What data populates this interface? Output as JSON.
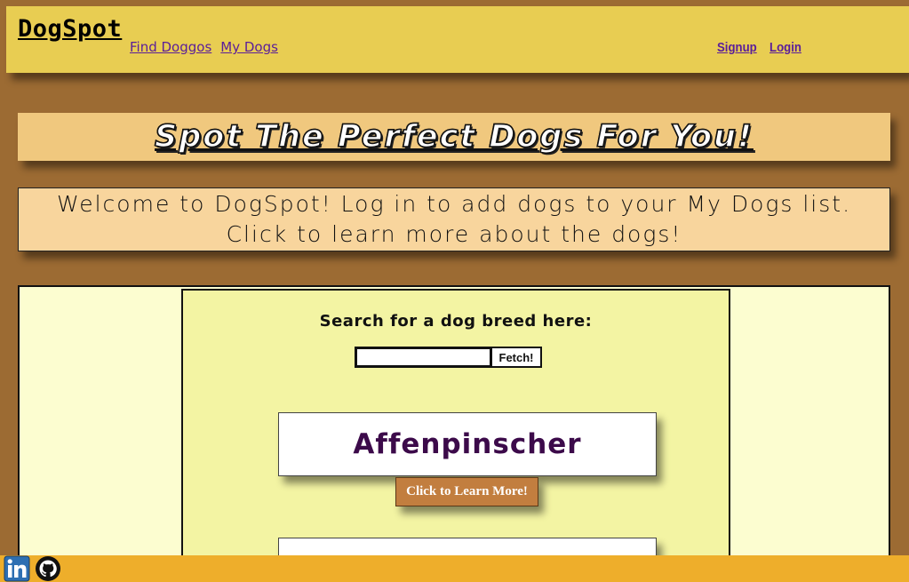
{
  "header": {
    "logo": "DogSpot",
    "nav_left": [
      "Find Doggos",
      "My Dogs"
    ],
    "nav_right": [
      "Signup",
      "Login"
    ]
  },
  "title_banner": {
    "text": "Spot The Perfect Dogs For You!"
  },
  "welcome_banner": {
    "line1": "Welcome to DogSpot! Log in to add dogs to your My Dogs list.",
    "line2": "Click to learn more about the dogs!"
  },
  "search": {
    "label": "Search for a dog breed here:",
    "input_value": "",
    "button_label": "Fetch!"
  },
  "breeds": [
    {
      "name": "Affenpinscher",
      "button_label": "Click to Learn More!"
    },
    {
      "name": ""
    }
  ],
  "footer": {
    "icons": [
      "linkedin-icon",
      "github-icon"
    ]
  },
  "colors": {
    "background": "#9c6b33",
    "header": "#e8cd52",
    "title_banner": "#f0c87e",
    "welcome_banner": "#f8d59d",
    "outer_panel": "#fcfdd0",
    "inner_panel": "#f3f4a3",
    "learn_button": "#c27e3f",
    "footer": "#eeae2b",
    "link": "#5a1d9a"
  }
}
